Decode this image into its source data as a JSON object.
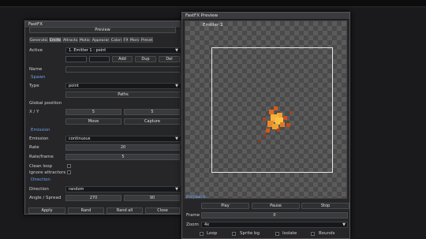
{
  "left_window": {
    "title": "FastFX",
    "preview_button": "Preview",
    "tabs": [
      "Generation",
      "Emitter",
      "Attractors",
      "Motion",
      "Appearance",
      "Colors",
      "FX",
      "Morse",
      "Presets"
    ],
    "active_tab": "Emitter",
    "active_label": "Active",
    "active_value": "1. Emitter 1 : point",
    "add_button": "Add",
    "dup_button": "Dup",
    "del_button": "Del",
    "name_label": "Name",
    "spawn_section": "Spawn",
    "type_label": "Type",
    "type_value": "point",
    "paths_button": "Paths",
    "global_position_label": "Global position",
    "xy_label": "X / Y",
    "x_value": "5",
    "y_value": "5",
    "move_button": "Move",
    "capture_button": "Capture",
    "emission_section": "Emission",
    "emission_label": "Emission",
    "emission_value": "continuous",
    "rate_label": "Rate",
    "rate_value": "20",
    "rate_frame_label": "Rate/frame",
    "rate_frame_value": "5",
    "clean_loop_label": "Clean loop",
    "ignore_attractors_label": "Ignore attractors",
    "direction_section": "Direction",
    "direction_label": "Direction",
    "direction_value": "random",
    "angle_spread_label": "Angle / Spread",
    "angle_value": "270",
    "spread_value": "90",
    "apply_button": "Apply",
    "rand_button": "Rand",
    "rand_all_button": "Rand all",
    "close_button": "Close"
  },
  "right_window": {
    "title": "FastFX Preview",
    "emitter_label": "Emitter 1",
    "playback_section": "Playback",
    "play_button": "Play",
    "pause_button": "Pause",
    "stop_button": "Stop",
    "frame_label": "Frame",
    "frame_value": "0",
    "zoom_label": "Zoom",
    "zoom_value": "4x",
    "loop_label": "Loop",
    "sprite_bg_label": "Sprite bg",
    "isolate_label": "Isolate",
    "bounds_label": "Bounds"
  },
  "colors": {
    "section_blue": "#6aa0e6",
    "particle_core": "#f5b339",
    "particle_edge": "#c8481a"
  }
}
